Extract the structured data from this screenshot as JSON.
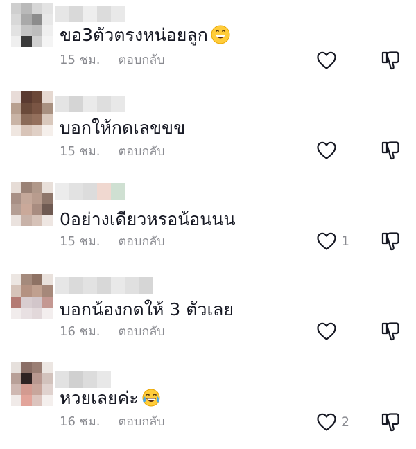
{
  "comments": [
    {
      "text": "ขอ3ตัวตรงหน่อยลูก",
      "emoji": "grinning-face-emoji",
      "time": "15 ชม.",
      "reply_label": "ตอบกลับ",
      "like_count": ""
    },
    {
      "text": "บอกให้กดเลขขข",
      "emoji": "",
      "time": "15 ชม.",
      "reply_label": "ตอบกลับ",
      "like_count": ""
    },
    {
      "text": "0อย่างเดียวหรอน้อนนน",
      "emoji": "",
      "time": "15 ชม.",
      "reply_label": "ตอบกลับ",
      "like_count": "1"
    },
    {
      "text": "บอกน้องกดให้ 3 ตัวเลย",
      "emoji": "",
      "time": "16 ชม.",
      "reply_label": "ตอบกลับ",
      "like_count": ""
    },
    {
      "text": "หวยเลยค่ะ",
      "emoji": "tears-of-joy-emoji",
      "time": "16 ชม.",
      "reply_label": "ตอบกลับ",
      "like_count": "2"
    }
  ],
  "icons": {
    "like": "heart-outline-icon",
    "dislike": "thumbs-down-outline-icon"
  },
  "colors": {
    "text": "#161823",
    "secondary": "#8a8b91",
    "icon": "#161823"
  }
}
